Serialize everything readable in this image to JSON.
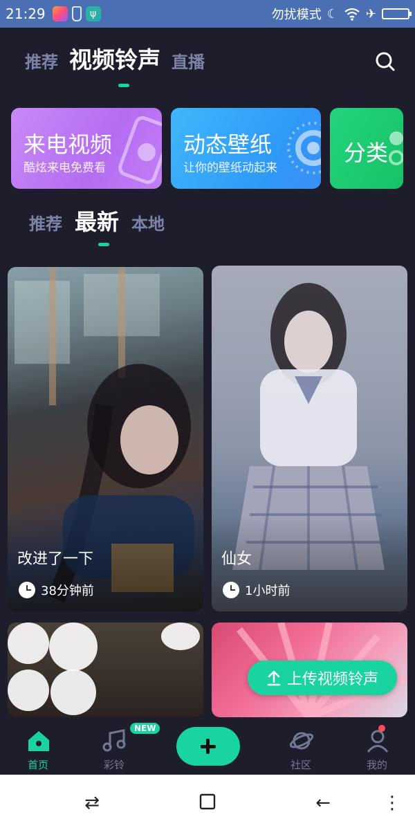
{
  "status_bar": {
    "time": "21:29",
    "dnd_text": "勿扰模式",
    "icons": [
      "app-icon",
      "broom-icon",
      "usb-icon",
      "moon-icon",
      "wifi-icon",
      "airplane-icon",
      "battery-icon"
    ]
  },
  "top_tabs": [
    {
      "label": "推荐",
      "active": false
    },
    {
      "label": "视频铃声",
      "active": true
    },
    {
      "label": "直播",
      "active": false
    }
  ],
  "feature_cards": [
    {
      "title": "来电视频",
      "subtitle": "酷炫来电免费看"
    },
    {
      "title": "动态壁纸",
      "subtitle": "让你的壁纸动起来"
    },
    {
      "title": "分类",
      "subtitle": ""
    }
  ],
  "sub_tabs": [
    {
      "label": "推荐",
      "active": false
    },
    {
      "label": "最新",
      "active": true
    },
    {
      "label": "本地",
      "active": false
    }
  ],
  "videos": [
    {
      "title": "改进了一下",
      "time": "38分钟前"
    },
    {
      "title": "仙女",
      "time": "1小时前"
    }
  ],
  "upload_button": {
    "label": "上传视频铃声"
  },
  "bottom_nav": {
    "home": "首页",
    "ringtone": "彩铃",
    "new_badge": "NEW",
    "community": "社区",
    "mine": "我的"
  },
  "colors": {
    "accent": "#19d3a0",
    "background": "#1e1d2c",
    "status_bar": "#4a70b3"
  }
}
